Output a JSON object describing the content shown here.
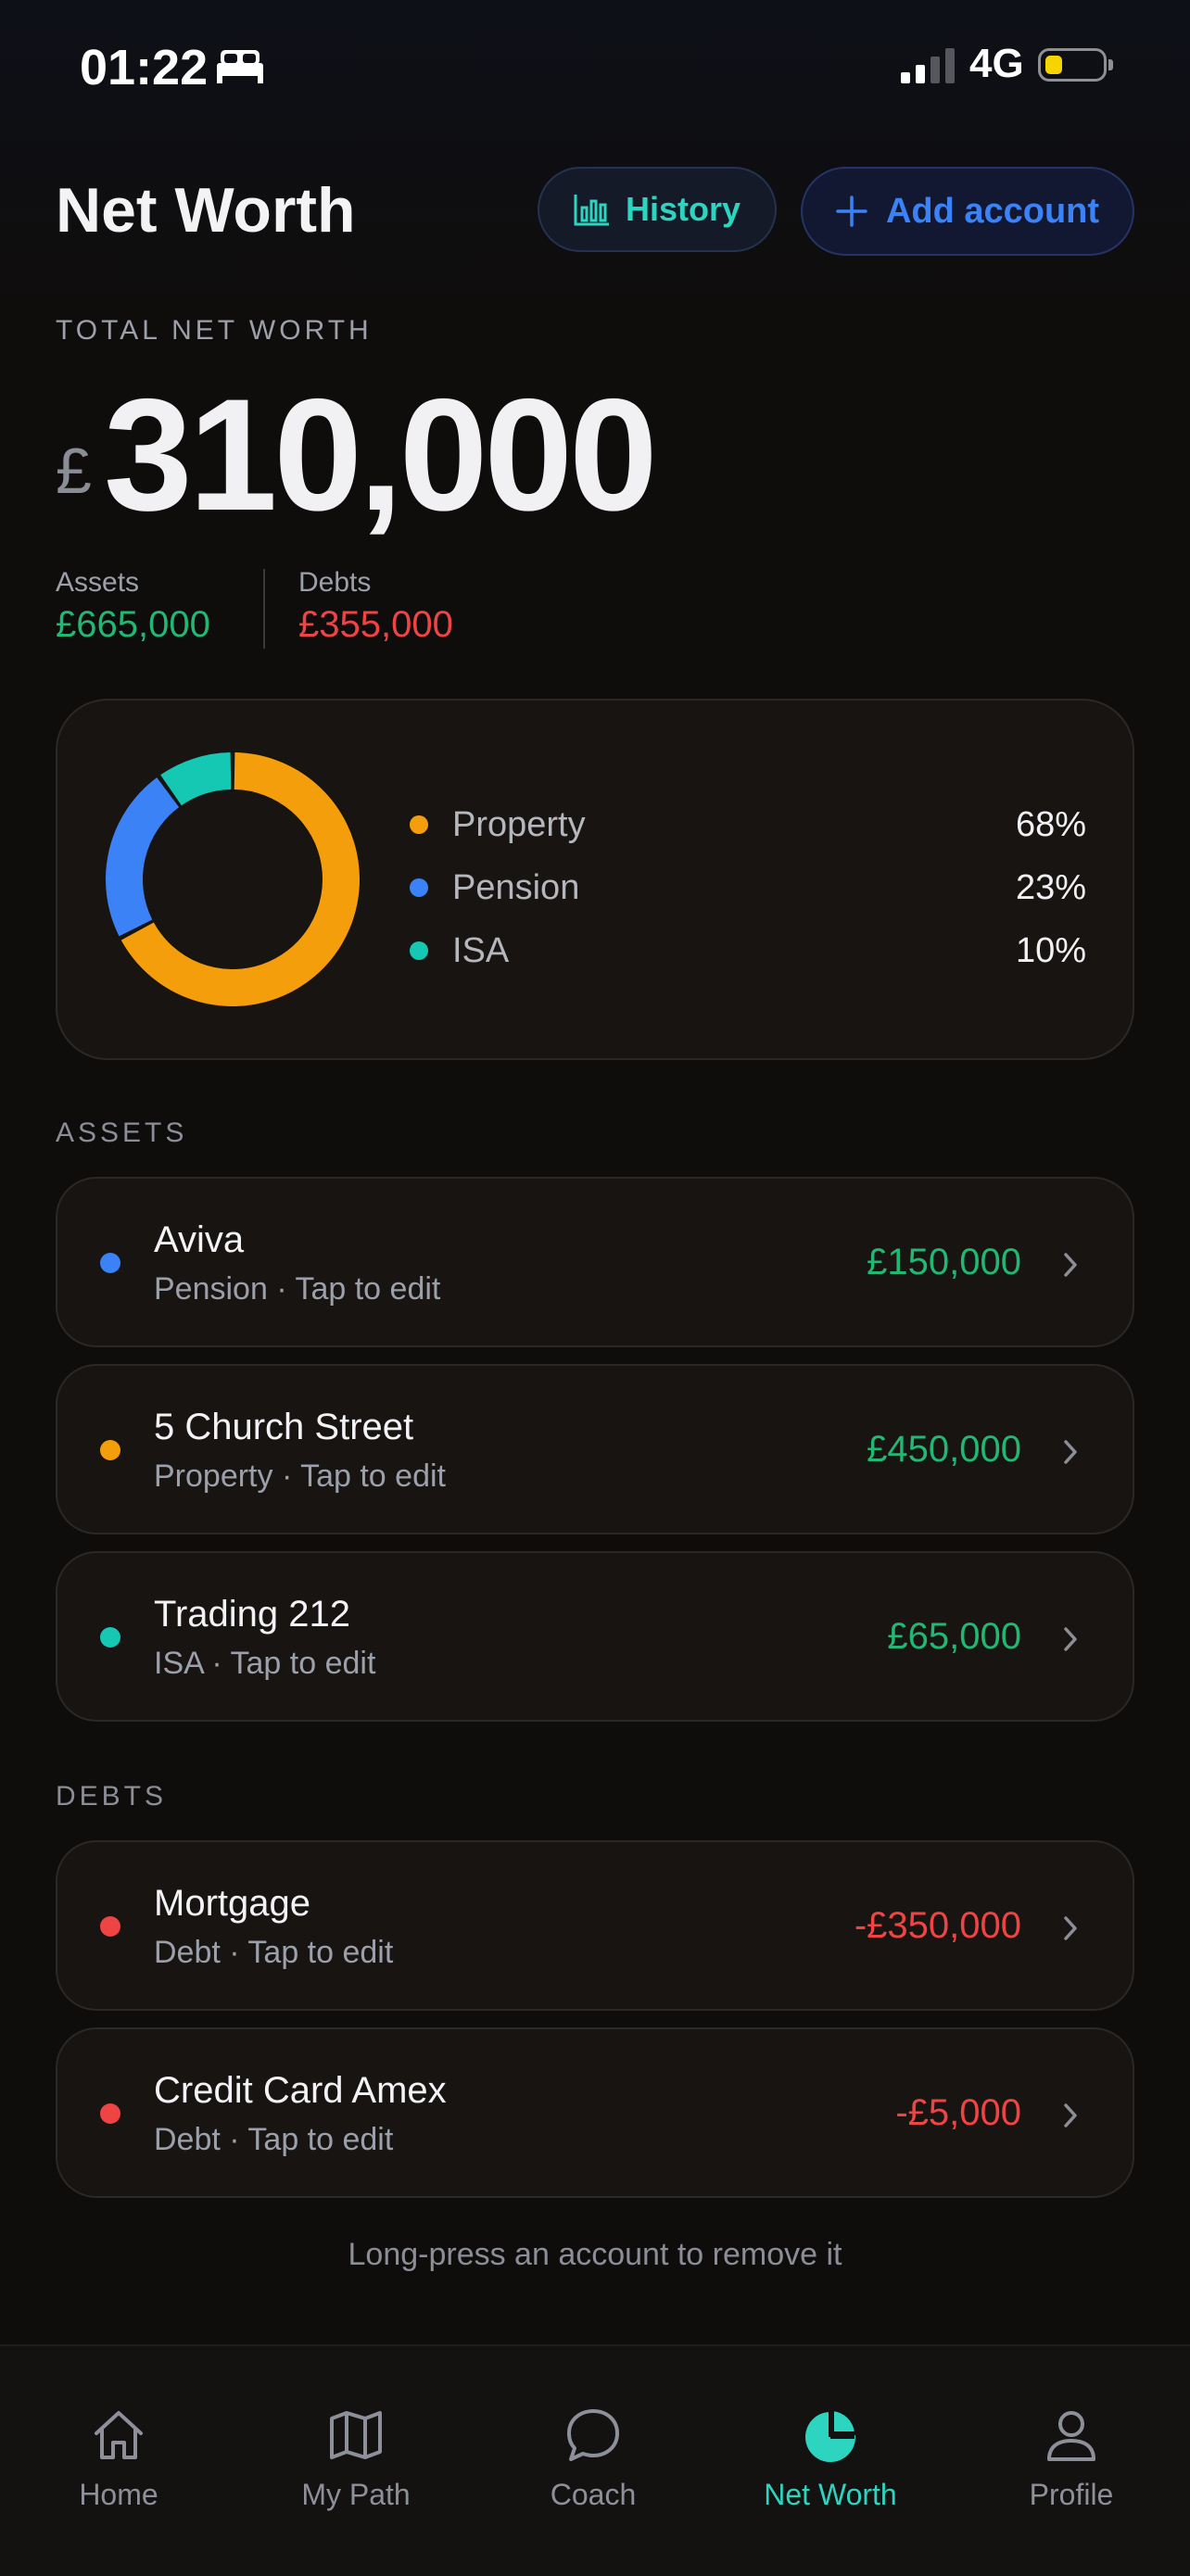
{
  "status_bar": {
    "time": "01:22",
    "network": "4G"
  },
  "header": {
    "title": "Net Worth",
    "history_label": "History",
    "add_account_label": "Add account"
  },
  "summary": {
    "total_label": "TOTAL NET WORTH",
    "currency": "£",
    "total": "310,000",
    "assets_label": "Assets",
    "assets_value": "£665,000",
    "debts_label": "Debts",
    "debts_value": "£355,000"
  },
  "colors": {
    "property": "#f59e0b",
    "pension": "#3b82f6",
    "isa": "#14c8b4",
    "debt": "#ef4444",
    "positive": "#22b873",
    "accent": "#2dd4bf"
  },
  "allocation": [
    {
      "name": "Property",
      "percent_label": "68%",
      "percent": 68,
      "color": "#f59e0b"
    },
    {
      "name": "Pension",
      "percent_label": "23%",
      "percent": 23,
      "color": "#3b82f6"
    },
    {
      "name": "ISA",
      "percent_label": "10%",
      "percent": 10,
      "color": "#14c8b4"
    }
  ],
  "assets_section": {
    "label": "ASSETS",
    "items": [
      {
        "name": "Aviva",
        "sub": "Pension · Tap to edit",
        "amount": "£150,000",
        "color": "#3b82f6"
      },
      {
        "name": "5 Church Street",
        "sub": "Property · Tap to edit",
        "amount": "£450,000",
        "color": "#f59e0b"
      },
      {
        "name": "Trading 212",
        "sub": "ISA · Tap to edit",
        "amount": "£65,000",
        "color": "#14c8b4"
      }
    ]
  },
  "debts_section": {
    "label": "DEBTS",
    "items": [
      {
        "name": "Mortgage",
        "sub": "Debt · Tap to edit",
        "amount": "-£350,000",
        "color": "#ef4444"
      },
      {
        "name": "Credit Card Amex",
        "sub": "Debt · Tap to edit",
        "amount": "-£5,000",
        "color": "#ef4444"
      }
    ]
  },
  "hint": "Long-press an account to remove it",
  "tabs": [
    {
      "label": "Home",
      "icon": "home-icon"
    },
    {
      "label": "My Path",
      "icon": "map-icon"
    },
    {
      "label": "Coach",
      "icon": "chat-bubble-icon"
    },
    {
      "label": "Net Worth",
      "icon": "pie-chart-icon",
      "active": true
    },
    {
      "label": "Profile",
      "icon": "person-icon"
    }
  ]
}
